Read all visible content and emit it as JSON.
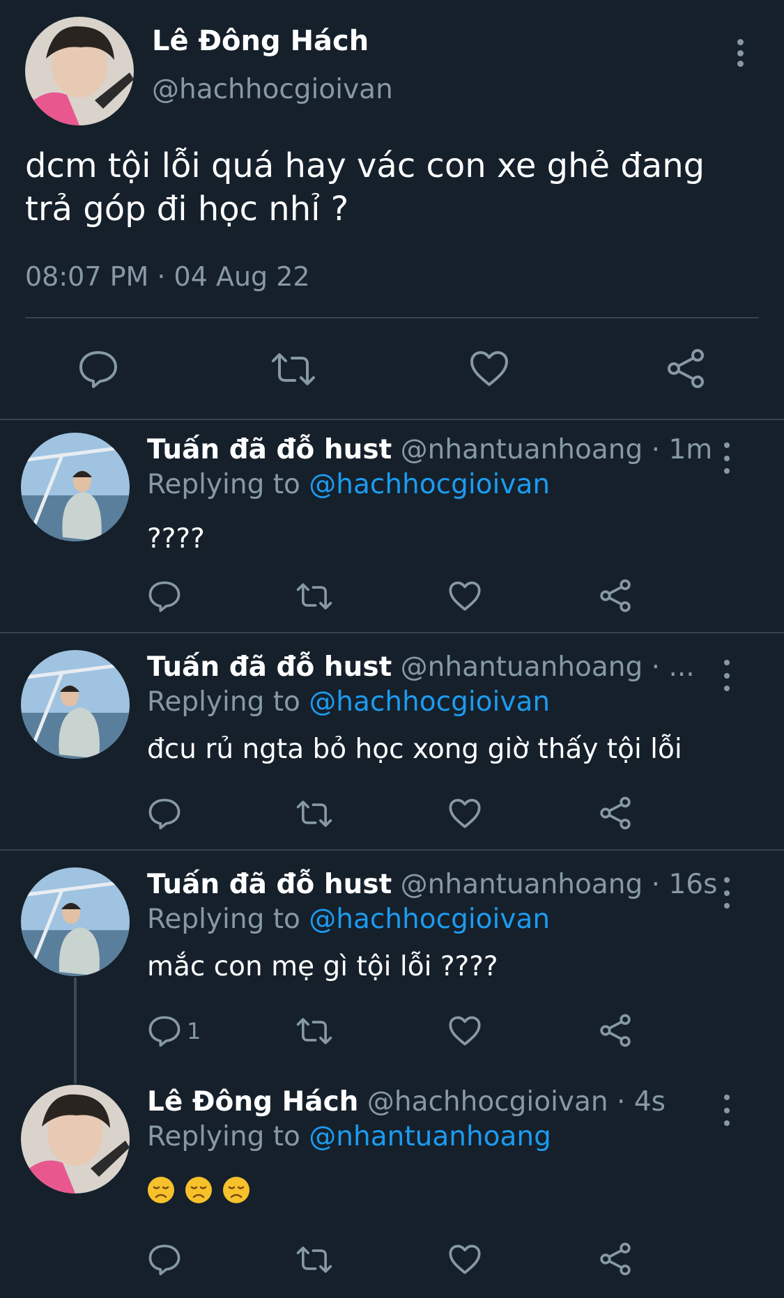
{
  "main_tweet": {
    "author_name": "Lê Đông Hách",
    "author_handle": "@hachhocgioivan",
    "text_line1": "dcm tội lỗi quá hay vác con xe ghẻ đang",
    "text_line2": "trả góp đi học nhỉ ?",
    "timestamp": "08:07 PM · 04 Aug 22",
    "actions": [
      "reply-icon",
      "retweet-icon",
      "like-icon",
      "share-icon"
    ]
  },
  "replies": [
    {
      "author_name": "Tuấn đã đỗ hust",
      "meta": " @nhantuanhoang · 1m",
      "replying_label": "Replying to ",
      "replying_to": "@hachhocgioivan",
      "text": "????",
      "reply_count": ""
    },
    {
      "author_name": "Tuấn đã đỗ hust",
      "meta": " @nhantuanhoang · ...",
      "replying_label": "Replying to ",
      "replying_to": "@hachhocgioivan",
      "text": "đcu rủ ngta bỏ học xong giờ thấy tội lỗi",
      "reply_count": ""
    },
    {
      "author_name": "Tuấn đã đỗ hust",
      "meta": " @nhantuanhoang · 16s",
      "replying_label": "Replying to ",
      "replying_to": "@hachhocgioivan",
      "text": "mắc con mẹ gì tội lỗi ????",
      "reply_count": "1"
    },
    {
      "author_name": "Lê Đông Hách",
      "meta": " @hachhocgioivan · 4s",
      "replying_label": "Replying to ",
      "replying_to": "@nhantuanhoang",
      "text": "",
      "reply_count": "",
      "emojis": [
        "disappointed-face-emoji",
        "disappointed-face-emoji",
        "disappointed-face-emoji"
      ]
    }
  ],
  "colors": {
    "background": "#15202b",
    "divider": "#38444d",
    "secondary_text": "#8899a6",
    "link": "#1d9bf0"
  }
}
